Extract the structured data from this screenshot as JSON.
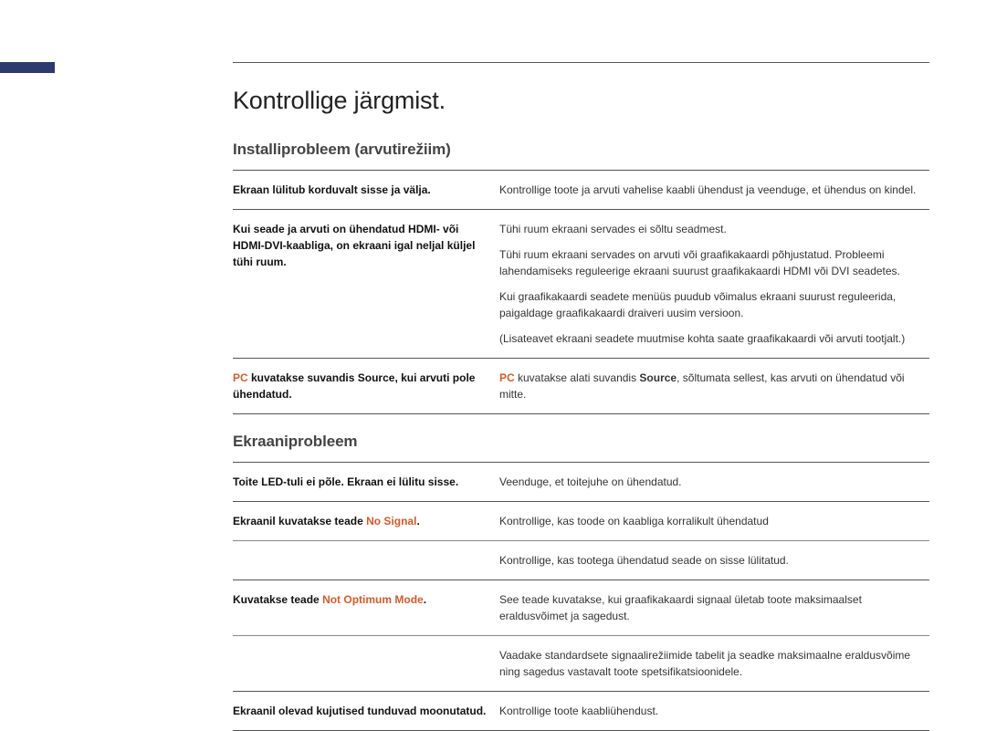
{
  "page_title": "Kontrollige järgmist.",
  "sections": [
    {
      "heading": "Installiprobleem (arvutirežiim)",
      "rows": [
        {
          "left_plain": "Ekraan lülitub korduvalt sisse ja välja.",
          "right_paras": [
            "Kontrollige toote ja arvuti vahelise kaabli ühendust ja veenduge, et ühendus on kindel."
          ],
          "border": "dark"
        },
        {
          "left_plain": "Kui seade ja arvuti on ühendatud HDMI- või HDMI-DVI-kaabliga, on ekraani igal neljal küljel tühi ruum.",
          "right_paras": [
            "Tühi ruum ekraani servades ei sõltu seadmest.",
            "Tühi ruum ekraani servades on arvuti või graafikakaardi põhjustatud. Probleemi lahendamiseks reguleerige ekraani suurust graafikakaardi HDMI või DVI seadetes.",
            "Kui graafikakaardi seadete menüüs puudub võimalus ekraani suurust reguleerida, paigaldage graafikakaardi draiveri uusim versioon.",
            "(Lisateavet ekraani seadete muutmise kohta saate graafikakaardi või arvuti tootjalt.)"
          ],
          "border": "dark"
        },
        {
          "left_parts": [
            {
              "accent": "PC",
              "text": " kuvatakse suvandis "
            },
            {
              "bold": "Source"
            },
            {
              "text": ", kui arvuti pole ühendatud."
            }
          ],
          "right_parts": [
            {
              "accent": "PC",
              "text": " kuvatakse alati suvandis "
            },
            {
              "bold": "Source"
            },
            {
              "text": ", sõltumata sellest, kas arvuti on ühendatud või mitte."
            }
          ],
          "border": "dark"
        }
      ]
    },
    {
      "heading": "Ekraaniprobleem",
      "rows": [
        {
          "left_plain": "Toite LED-tuli ei põle. Ekraan ei lülitu sisse.",
          "right_paras": [
            "Veenduge, et toitejuhe on ühendatud."
          ],
          "border": "dark"
        },
        {
          "left_parts": [
            {
              "text": "Ekraanil kuvatakse teade "
            },
            {
              "accent": "No Signal"
            },
            {
              "text": "."
            }
          ],
          "right_paras": [
            "Kontrollige, kas toode on kaabliga korralikult ühendatud"
          ],
          "border": "light"
        },
        {
          "right_paras": [
            "Kontrollige, kas tootega ühendatud seade on sisse lülitatud."
          ],
          "border": "dark"
        },
        {
          "left_parts": [
            {
              "text": "Kuvatakse teade "
            },
            {
              "accent": "Not Optimum Mode"
            },
            {
              "text": "."
            }
          ],
          "right_paras": [
            "See teade kuvatakse, kui graafikakaardi signaal ületab toote maksimaalset eraldusvõimet ja sagedust."
          ],
          "border": "light"
        },
        {
          "right_paras": [
            "Vaadake standardsete signaalirežiimide tabelit ja seadke maksimaalne eraldusvõime ning sagedus vastavalt toote spetsifikatsioonidele."
          ],
          "border": "dark"
        },
        {
          "left_plain": "Ekraanil olevad kujutised tunduvad moonutatud.",
          "right_paras": [
            "Kontrollige toote kaabliühendust."
          ],
          "border": "dark"
        }
      ]
    }
  ]
}
